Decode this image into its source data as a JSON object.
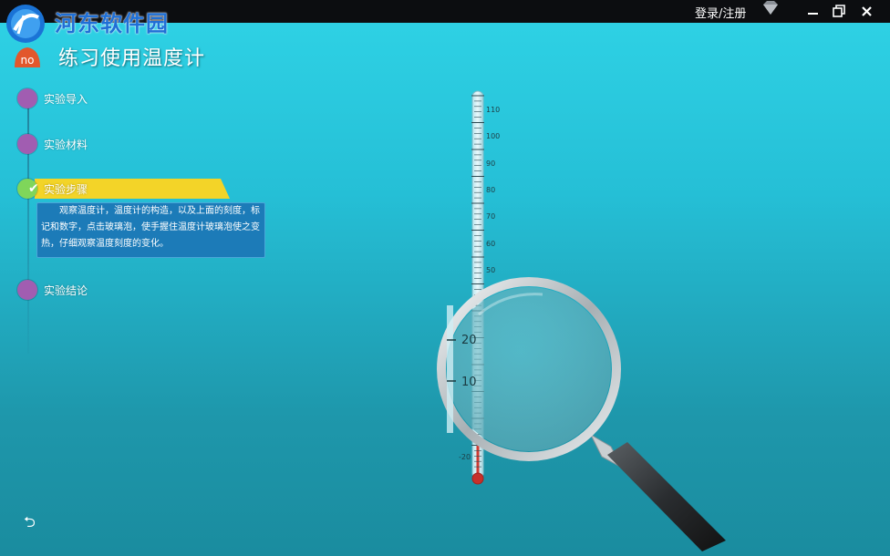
{
  "watermark": "河东软件园",
  "topbar": {
    "login_label": "登录/注册",
    "icons": [
      "gem-icon",
      "minimize-icon",
      "restore-icon",
      "close-icon"
    ]
  },
  "app": {
    "title": "练习使用温度计",
    "icon_text": "no"
  },
  "steps": [
    {
      "label": "实验导入",
      "active": false
    },
    {
      "label": "实验材料",
      "active": false
    },
    {
      "label": "实验步骤",
      "active": true
    },
    {
      "label": "实验结论",
      "active": false
    }
  ],
  "description": "观察温度计，温度计的构造，以及上面的刻度，标记和数字，点击玻璃泡，使手握住温度计玻璃泡使之变热，仔细观察温度刻度的变化。",
  "thermometer": {
    "scale_labels": [
      "110",
      "100",
      "90",
      "80",
      "70",
      "60",
      "50",
      "-20"
    ],
    "magnified_labels": [
      "20",
      "10"
    ]
  },
  "colors": {
    "accent_yellow": "#f3d428",
    "step_dot": "#a15db1",
    "step_active": "#7fd65a",
    "desc_bg": "#1c7bb8"
  }
}
